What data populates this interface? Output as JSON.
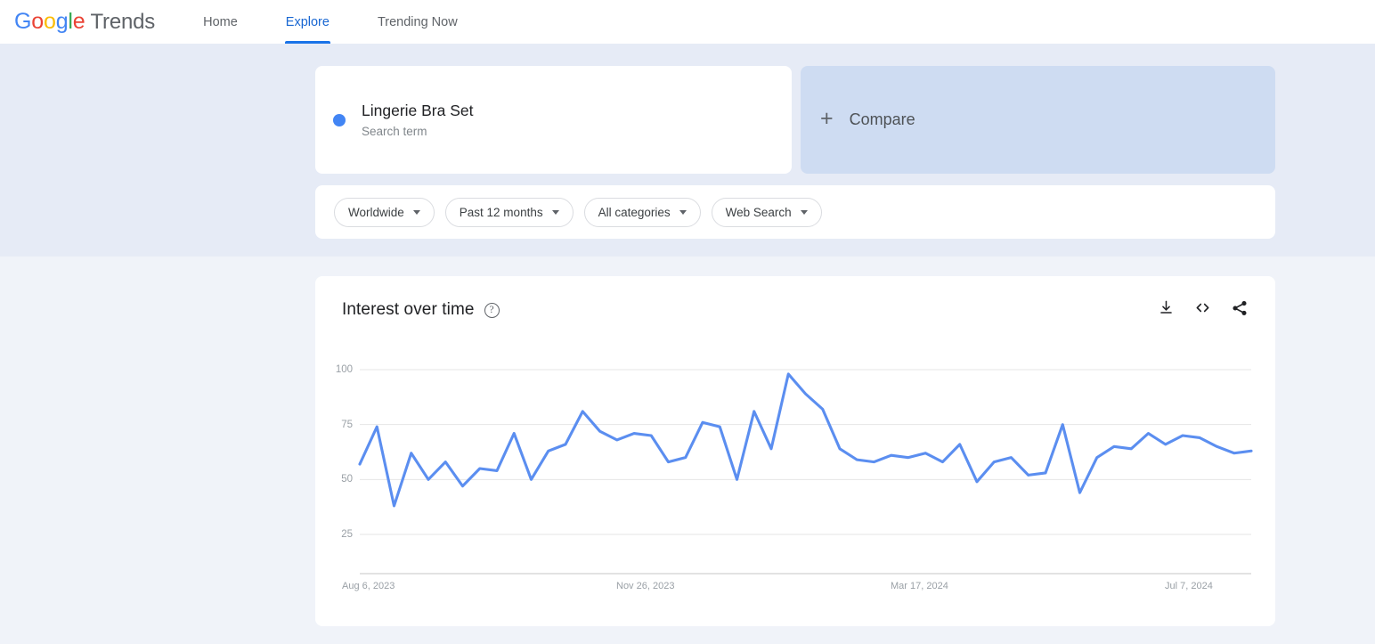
{
  "brand": {
    "google": [
      "G",
      "o",
      "o",
      "g",
      "l",
      "e"
    ],
    "google_colors": [
      "#4285F4",
      "#EA4335",
      "#FBBC05",
      "#4285F4",
      "#34A853",
      "#EA4335"
    ],
    "suffix": "Trends"
  },
  "nav": {
    "items": [
      {
        "label": "Home",
        "active": false
      },
      {
        "label": "Explore",
        "active": true
      },
      {
        "label": "Trending Now",
        "active": false
      }
    ]
  },
  "term": {
    "title": "Lingerie Bra Set",
    "subtitle": "Search term",
    "dot_color": "#4285F4"
  },
  "compare": {
    "plus": "+",
    "label": "Compare"
  },
  "filters": [
    {
      "label": "Worldwide"
    },
    {
      "label": "Past 12 months"
    },
    {
      "label": "All categories"
    },
    {
      "label": "Web Search"
    }
  ],
  "chart_panel": {
    "title": "Interest over time",
    "help_glyph": "?",
    "actions": [
      {
        "name": "download-icon",
        "tooltip": "Download"
      },
      {
        "name": "embed-code-icon",
        "tooltip": "Embed"
      },
      {
        "name": "share-icon",
        "tooltip": "Share"
      }
    ]
  },
  "chart_data": {
    "type": "line",
    "title": "Interest over time",
    "xlabel": "",
    "ylabel": "",
    "ylim": [
      0,
      105
    ],
    "yticks": [
      100,
      75,
      50,
      25
    ],
    "grid": true,
    "legend": false,
    "line_color": "#5b8ef0",
    "xticks": [
      "Aug 6, 2023",
      "Nov 26, 2023",
      "Mar 17, 2024",
      "Jul 7, 2024"
    ],
    "xtick_indices": [
      0,
      16,
      32,
      48
    ],
    "series": [
      {
        "name": "Lingerie Bra Set",
        "values": [
          57,
          74,
          38,
          62,
          50,
          58,
          47,
          55,
          54,
          71,
          50,
          63,
          66,
          81,
          72,
          68,
          71,
          70,
          58,
          60,
          76,
          74,
          50,
          81,
          64,
          98,
          89,
          82,
          64,
          59,
          58,
          61,
          60,
          62,
          58,
          66,
          49,
          58,
          60,
          52,
          53,
          75,
          44,
          60,
          65,
          64,
          71,
          66,
          70,
          69,
          65,
          62,
          63
        ]
      }
    ]
  }
}
